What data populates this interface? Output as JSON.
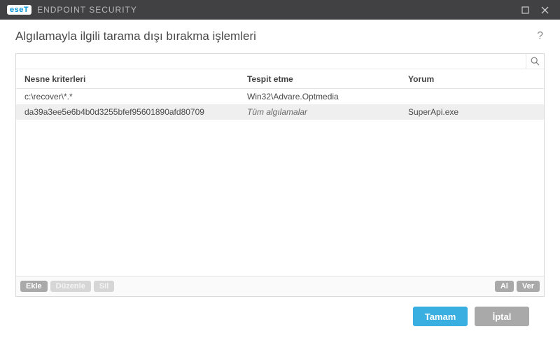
{
  "titlebar": {
    "brand_short": "eseT",
    "product": "ENDPOINT SECURITY"
  },
  "header": {
    "title": "Algılamayla ilgili tarama dışı bırakma işlemleri",
    "help": "?"
  },
  "search": {
    "value": "",
    "placeholder": ""
  },
  "table": {
    "columns": {
      "object": "Nesne kriterleri",
      "detection": "Tespit etme",
      "comment": "Yorum"
    },
    "rows": [
      {
        "object": "c:\\recover\\*.*",
        "detection": "Win32\\Advare.Optmedia",
        "comment": "",
        "italic": false
      },
      {
        "object": "da39a3ee5e6b4b0d3255bfef95601890afd80709",
        "detection": "Tüm algılamalar",
        "comment": "SuperApi.exe",
        "italic": true
      }
    ]
  },
  "panel_buttons": {
    "add": "Ekle",
    "edit": "Düzenle",
    "delete": "Sil",
    "import": "Al",
    "export": "Ver"
  },
  "footer": {
    "ok": "Tamam",
    "cancel": "İptal"
  }
}
